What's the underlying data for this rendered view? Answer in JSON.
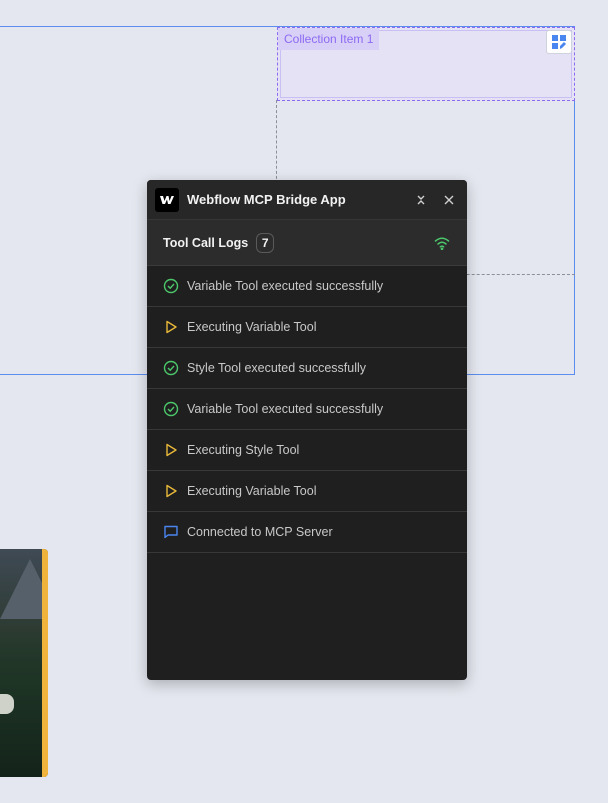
{
  "canvas": {
    "collection_item_label": "Collection Item 1"
  },
  "panel": {
    "title": "Webflow MCP Bridge App",
    "logs_title": "Tool Call Logs",
    "logs_count": "7",
    "logs": [
      {
        "status": "success",
        "icon": "check-circle-icon",
        "text": "Variable Tool executed successfully"
      },
      {
        "status": "running",
        "icon": "play-icon",
        "text": "Executing Variable Tool"
      },
      {
        "status": "success",
        "icon": "check-circle-icon",
        "text": "Style Tool executed successfully"
      },
      {
        "status": "success",
        "icon": "check-circle-icon",
        "text": "Variable Tool executed successfully"
      },
      {
        "status": "running",
        "icon": "play-icon",
        "text": "Executing Style Tool"
      },
      {
        "status": "running",
        "icon": "play-icon",
        "text": "Executing Variable Tool"
      },
      {
        "status": "info",
        "icon": "message-icon",
        "text": "Connected to MCP Server"
      }
    ]
  },
  "colors": {
    "success": "#4cc76b",
    "running": "#e8b83a",
    "info": "#4a86f0",
    "collection_accent": "#8d6af2",
    "selection_blue": "#5b8def"
  }
}
